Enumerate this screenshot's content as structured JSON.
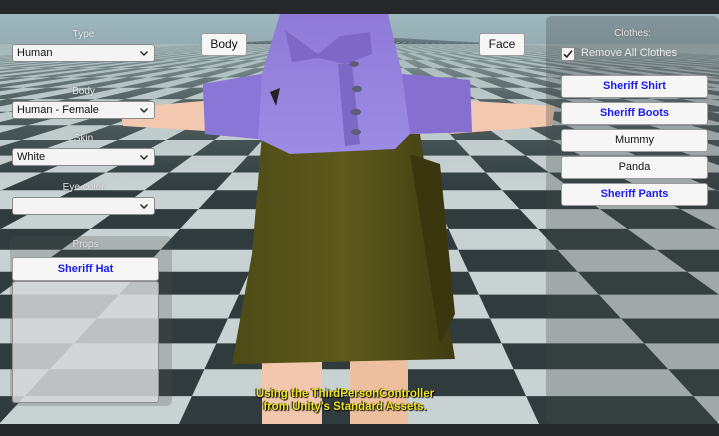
{
  "top_buttons": {
    "body": "Body",
    "face": "Face"
  },
  "left_panel": {
    "type_label": "Type",
    "type_value": "Human",
    "body_label": "Body",
    "body_value": "Human - Female",
    "skin_label": "Skin",
    "skin_value": "White",
    "eye_color_label": "Eye color",
    "eye_color_value": "",
    "props_label": "Props",
    "props": [
      "Sheriff Hat"
    ]
  },
  "right_panel": {
    "title": "Clothes:",
    "remove_all_label": "Remove All Clothes",
    "remove_all_checked": true,
    "clothes": [
      {
        "label": "Sheriff Shirt",
        "equipped": true
      },
      {
        "label": "Sheriff Boots",
        "equipped": true
      },
      {
        "label": "Mummy",
        "equipped": false
      },
      {
        "label": "Panda",
        "equipped": false
      },
      {
        "label": "Sheriff Pants",
        "equipped": true
      }
    ]
  },
  "caption": {
    "line1": "Using the ThirdPersonController",
    "line2": "from Unity's Standard Assets."
  },
  "icons": [
    "chevron-down-icon",
    "checkmark-icon"
  ]
}
